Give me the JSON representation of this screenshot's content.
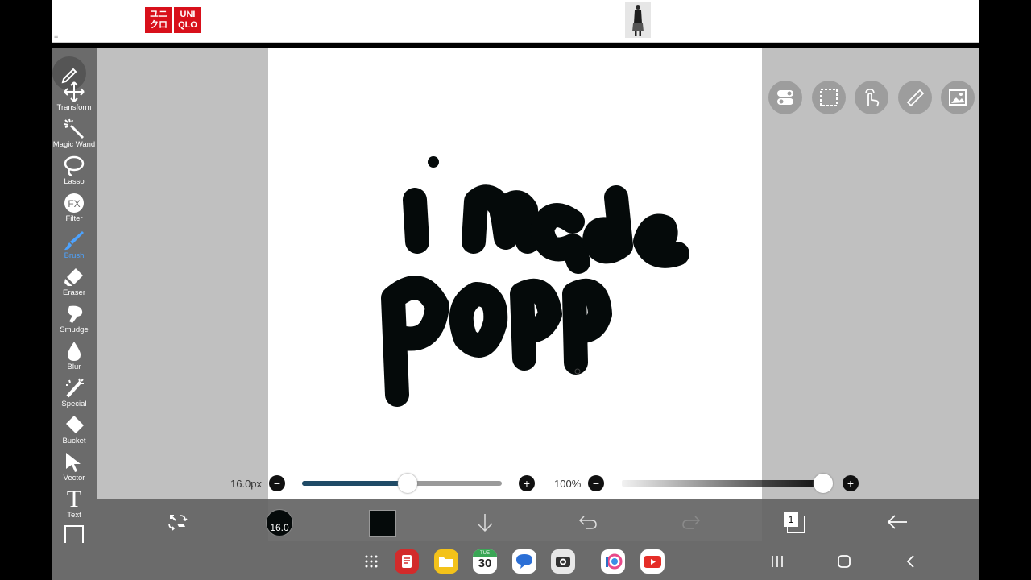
{
  "ad": {
    "logo_top": "ユニ\nクロ",
    "logo_bottom": "UNI\nQLO",
    "corner_mark": "≡"
  },
  "toolbar": {
    "items": [
      {
        "label": "Transform",
        "icon": "transform-icon"
      },
      {
        "label": "Magic Wand",
        "icon": "magic-wand-icon"
      },
      {
        "label": "Lasso",
        "icon": "lasso-icon"
      },
      {
        "label": "Filter",
        "icon": "fx-icon"
      },
      {
        "label": "Brush",
        "icon": "brush-icon"
      },
      {
        "label": "Eraser",
        "icon": "eraser-icon"
      },
      {
        "label": "Smudge",
        "icon": "smudge-icon"
      },
      {
        "label": "Blur",
        "icon": "blur-icon"
      },
      {
        "label": "Special",
        "icon": "special-icon"
      },
      {
        "label": "Bucket",
        "icon": "bucket-icon"
      },
      {
        "label": "Vector",
        "icon": "vector-icon"
      },
      {
        "label": "Text",
        "icon": "text-icon"
      }
    ],
    "active": "Brush",
    "fx_text": "FX",
    "text_glyph": "T"
  },
  "right_tools": [
    "toggle-icon",
    "selection-icon",
    "gesture-icon",
    "ruler-icon",
    "image-icon"
  ],
  "sliders": {
    "brush_size_label": "16.0px",
    "brush_size_fraction": 0.53,
    "opacity_label": "100%",
    "opacity_fraction": 1.0,
    "minus": "−",
    "plus": "+"
  },
  "bottom_bar": {
    "brush_size_badge": "16.0",
    "color": "#050a0a",
    "layer_count": "1"
  },
  "canvas_text": "i made popp",
  "taskbar": {
    "calendar_day": "TUE",
    "calendar_date": "30"
  },
  "colors": {
    "toolbar": "#6b6b6b",
    "workspace": "#c0c0c0",
    "accent": "#4da3ff",
    "ink": "#050a0a",
    "slider_fill": "#1f4a66"
  }
}
